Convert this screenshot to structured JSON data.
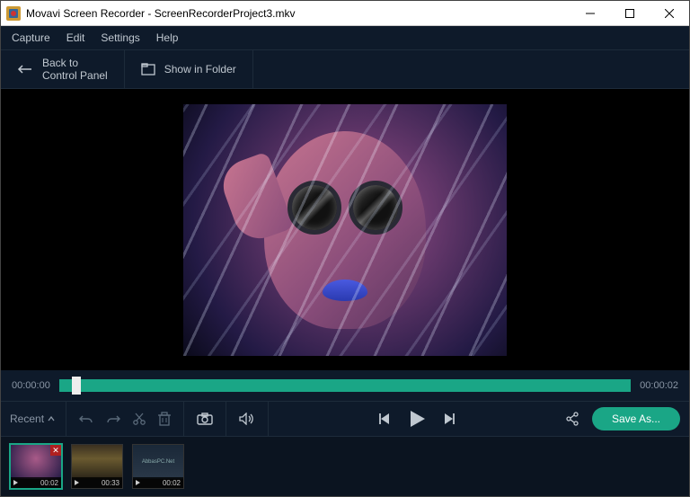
{
  "window": {
    "title": "Movavi Screen Recorder - ScreenRecorderProject3.mkv"
  },
  "menu": {
    "capture": "Capture",
    "edit": "Edit",
    "settings": "Settings",
    "help": "Help"
  },
  "top": {
    "back": "Back to\nControl Panel",
    "show": "Show in Folder"
  },
  "timeline": {
    "start": "00:00:00",
    "end": "00:00:02"
  },
  "controls": {
    "recent": "Recent",
    "save": "Save As..."
  },
  "thumbs": {
    "t1": {
      "time": "00:02"
    },
    "t2": {
      "time": "00:33"
    },
    "t3": {
      "text": "AbbasPC.Net",
      "time": "00:02"
    }
  }
}
